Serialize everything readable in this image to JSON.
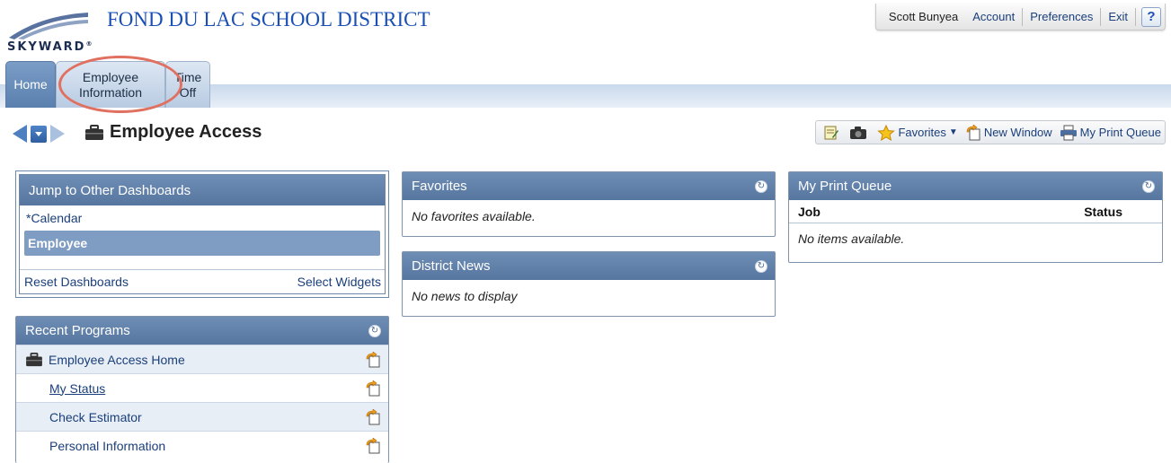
{
  "header": {
    "logo_text": "SKYWARD",
    "logo_tm": "®",
    "district_title": "FOND DU LAC SCHOOL DISTRICT"
  },
  "user_bar": {
    "user_name": "Scott Bunyea",
    "account": "Account",
    "preferences": "Preferences",
    "exit": "Exit",
    "help": "?"
  },
  "tabs": [
    {
      "label": "Home",
      "active": true
    },
    {
      "label": "Employee\nInformation",
      "highlighted": true
    },
    {
      "label": "Time\nOff"
    }
  ],
  "page": {
    "title": "Employee Access"
  },
  "toolbar": {
    "icons": [
      "notes-icon",
      "camera-icon"
    ],
    "favorites": "Favorites",
    "new_window": "New Window",
    "print_queue": "My Print Queue"
  },
  "jump": {
    "title": "Jump to Other Dashboards",
    "items": [
      {
        "label": "*Calendar",
        "active": false
      },
      {
        "label": "Employee",
        "active": true
      }
    ],
    "reset": "Reset Dashboards",
    "select_widgets": "Select Widgets"
  },
  "recent": {
    "title": "Recent Programs",
    "items": [
      {
        "label": "Employee Access Home",
        "icon": "briefcase-icon"
      },
      {
        "label": "My Status"
      },
      {
        "label": "Check Estimator"
      },
      {
        "label": "Personal Information"
      }
    ]
  },
  "favorites": {
    "title": "Favorites",
    "empty": "No favorites available."
  },
  "news": {
    "title": "District News",
    "empty": "No news to display"
  },
  "print_queue": {
    "title": "My Print Queue",
    "col_job": "Job",
    "col_status": "Status",
    "empty": "No items available."
  },
  "colors": {
    "title_blue": "#1a50b4",
    "widget_header": "#6484ac",
    "tab_highlight_ring": "#e07060"
  }
}
